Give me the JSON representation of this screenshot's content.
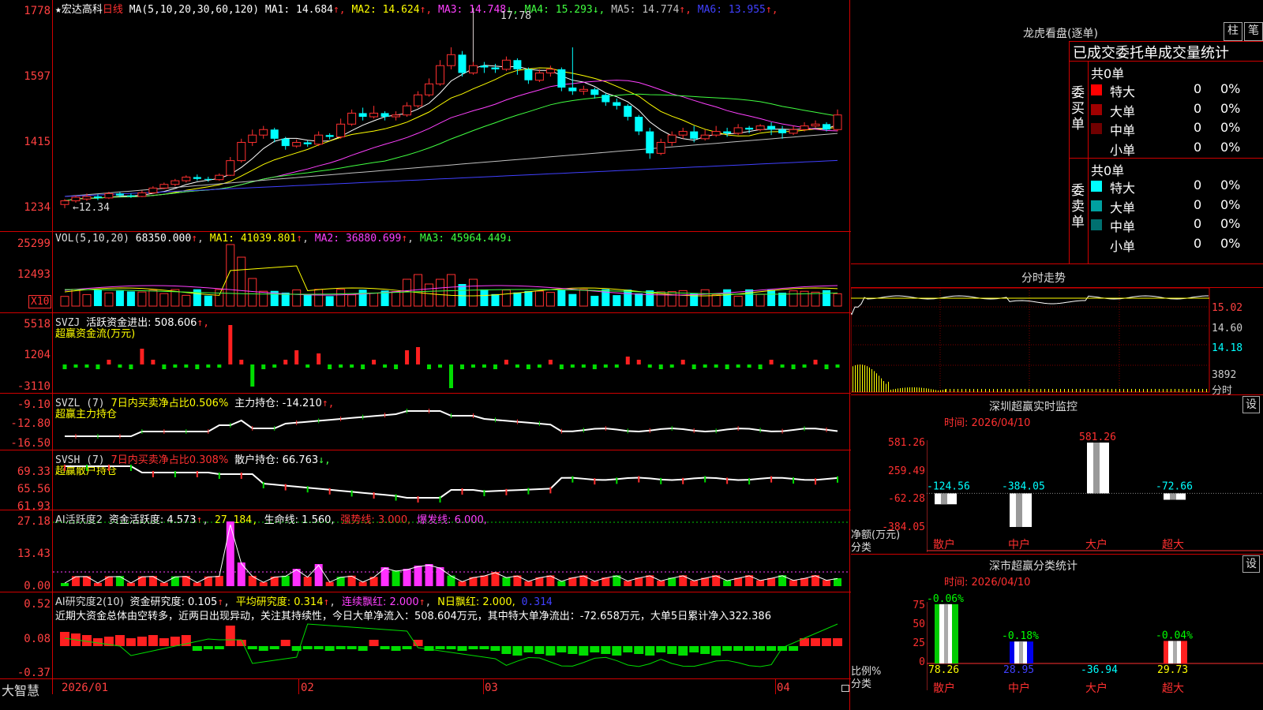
{
  "main": {
    "title_star": "★",
    "stock_name": "宏达高科",
    "period": "日线",
    "ma_label": "MA(5,10,20,30,60,120)",
    "ma": [
      {
        "name": "MA1: 14.684",
        "arrow": "↑",
        "color": "#ffffff"
      },
      {
        "name": "MA2: 14.624",
        "arrow": "↑",
        "color": "#ffff00"
      },
      {
        "name": "MA3: 14.748",
        "arrow": "↓",
        "color": "#ff40ff"
      },
      {
        "name": "MA4: 15.293",
        "arrow": "↓",
        "color": "#40ff40"
      },
      {
        "name": "MA5: 14.774",
        "arrow": "↑",
        "color": "#c0c0c0"
      },
      {
        "name": "MA6: 13.955",
        "arrow": "↑",
        "color": "#4040ff"
      }
    ],
    "high_label": "17.78",
    "low_label": "←12.34",
    "y_ticks": [
      "1778",
      "1597",
      "1415",
      "1234"
    ],
    "bottom_label": "大智慧",
    "x_labels": [
      "2026/01",
      "02",
      "03",
      "04"
    ]
  },
  "vol": {
    "label": "VOL(5,10,20)",
    "value": "68350.000",
    "arrow": "↑",
    "ma1": "MA1: 41039.801",
    "ma1_arrow": "↑",
    "ma2": "MA2: 36880.699",
    "ma2_arrow": "↑",
    "ma3": "MA3: 45964.449",
    "ma3_arrow": "↓",
    "y_ticks": [
      "25299",
      "12493"
    ],
    "unit": "X10"
  },
  "svzj": {
    "label": "SVZJ",
    "desc": "活跃资金进出: 508.606",
    "arrow": "↑,",
    "sub": "超赢资金流(万元)",
    "y_ticks": [
      "5518",
      "1204",
      "-3110"
    ]
  },
  "svzl": {
    "label": "SVZL (7)",
    "desc1": "7日内买卖净占比0.506%",
    "desc2": "主力持仓: -14.210",
    "arrow": "↑,",
    "sub": "超赢主力持仓",
    "y_ticks": [
      "-9.10",
      "-12.80",
      "-16.50"
    ]
  },
  "svsh": {
    "label": "SVSH (7)",
    "desc1": "7日内买卖净占比0.308%",
    "desc2": "散户持仓: 66.763",
    "arrow": "↓,",
    "sub": "超赢散户持仓",
    "y_ticks": [
      "69.33",
      "65.56",
      "61.93"
    ]
  },
  "ai1": {
    "label": "AI活跃度2",
    "desc": "资金活跃度: 4.573",
    "v2": "27.184,",
    "v3": "生命线: 1.560,",
    "v4": "强势线: 3.000,",
    "v5": "爆发线: 6.000,",
    "y_ticks": [
      "27.18",
      "13.43",
      "0.00"
    ]
  },
  "ai2": {
    "label": "AI研究度2(10)",
    "desc": "资金研究度: 0.105",
    "v2": "平均研究度: 0.314",
    "v3": "连续飘红: 2.000",
    "v4": "N日飘红: 2.000,",
    "v5": "0.314",
    "comment": "近期大资金总体由空转多，近两日出现异动，关注其持续性，今日大单净流入：508.604万元，其中特大单净流出：-72.658万元，大单5日累计净入322.386",
    "y_ticks": [
      "0.52",
      "0.08",
      "-0.37"
    ]
  },
  "right": {
    "title": "龙虎看盘(逐单)",
    "btn1": "柱",
    "btn2": "笔",
    "header": "已成交委托单成交量统计",
    "buy_label": "委买单",
    "sell_label": "委卖单",
    "buy_total": "共0单",
    "sell_total": "共0单",
    "buy_rows": [
      {
        "name": "特大",
        "count": "0",
        "pct": "0%",
        "color": "#ff0000"
      },
      {
        "name": "大单",
        "count": "0",
        "pct": "0%",
        "color": "#a00000"
      },
      {
        "name": "中单",
        "count": "0",
        "pct": "0%",
        "color": "#700000"
      },
      {
        "name": "小单",
        "count": "0",
        "pct": "0%",
        "color": ""
      }
    ],
    "sell_rows": [
      {
        "name": "特大",
        "count": "0",
        "pct": "0%",
        "color": "#00ffff"
      },
      {
        "name": "大单",
        "count": "0",
        "pct": "0%",
        "color": "#00a0a0"
      },
      {
        "name": "中单",
        "count": "0",
        "pct": "0%",
        "color": "#007070"
      },
      {
        "name": "小单",
        "count": "0",
        "pct": "0%",
        "color": ""
      }
    ],
    "intraday_title": "分时走势",
    "intraday_ticks": [
      "15.02",
      "14.60",
      "14.18",
      "3892",
      "分时"
    ],
    "sz_title": "深圳超赢实时监控",
    "sz_btn": "设",
    "sz_time": "时间: 2026/04/10",
    "sz_y": [
      "581.26",
      "259.49",
      "-62.28",
      "-384.05"
    ],
    "sz_axis": "净额(万元)",
    "sz_axis2": "分类",
    "sz_bars": [
      {
        "cat": "散户",
        "val": "-124.56",
        "value": -124.56
      },
      {
        "cat": "中户",
        "val": "-384.05",
        "value": -384.05
      },
      {
        "cat": "大户",
        "val": "581.26",
        "value": 581.26
      },
      {
        "cat": "超大",
        "val": "-72.66",
        "value": -72.66
      }
    ],
    "cls_title": "深市超赢分类统计",
    "cls_btn": "设",
    "cls_time": "时间: 2026/04/10",
    "cls_y": [
      "75",
      "50",
      "25",
      "0"
    ],
    "cls_axis": "比例%",
    "cls_axis2": "分类",
    "cls_bars": [
      {
        "cat": "散户",
        "top": "-0.06%",
        "bottom": "78.26",
        "value": 78.26
      },
      {
        "cat": "中户",
        "top": "-0.18%",
        "bottom": "28.95",
        "value": 28.95
      },
      {
        "cat": "大户",
        "top": "",
        "bottom": "-36.94",
        "value": 0
      },
      {
        "cat": "超大",
        "top": "-0.04%",
        "bottom": "29.73",
        "value": 29.73
      }
    ]
  },
  "chart_data": [
    {
      "type": "candlestick",
      "title": "宏达高科 日线",
      "ylim": [
        12.34,
        17.78
      ],
      "series": [
        {
          "name": "price",
          "values": [
            [
              12.4,
              12.5,
              12.3,
              12.55
            ],
            [
              12.5,
              12.6,
              12.45,
              12.65
            ],
            [
              12.55,
              12.62,
              12.5,
              12.7
            ],
            [
              12.62,
              12.58,
              12.52,
              12.68
            ],
            [
              12.58,
              12.7,
              12.55,
              12.75
            ],
            [
              12.7,
              12.65,
              12.6,
              12.74
            ],
            [
              12.65,
              12.62,
              12.58,
              12.7
            ],
            [
              12.62,
              12.72,
              12.6,
              12.78
            ],
            [
              12.72,
              12.85,
              12.7,
              12.9
            ],
            [
              12.85,
              12.95,
              12.82,
              13.0
            ],
            [
              12.95,
              13.05,
              12.9,
              13.1
            ],
            [
              13.05,
              13.15,
              13.0,
              13.2
            ],
            [
              13.15,
              13.1,
              13.05,
              13.22
            ],
            [
              13.1,
              13.08,
              13.02,
              13.16
            ],
            [
              13.08,
              13.2,
              13.05,
              13.25
            ],
            [
              13.2,
              13.6,
              13.18,
              13.7
            ],
            [
              13.6,
              14.1,
              13.55,
              14.2
            ],
            [
              14.1,
              14.3,
              14.0,
              14.45
            ],
            [
              14.3,
              14.45,
              14.2,
              14.55
            ],
            [
              14.45,
              14.2,
              14.1,
              14.5
            ],
            [
              14.2,
              14.0,
              13.9,
              14.25
            ],
            [
              14.0,
              14.1,
              13.95,
              14.18
            ],
            [
              14.1,
              14.05,
              13.98,
              14.15
            ],
            [
              14.05,
              14.3,
              14.0,
              14.4
            ],
            [
              14.3,
              14.25,
              14.18,
              14.35
            ],
            [
              14.25,
              14.6,
              14.2,
              14.75
            ],
            [
              14.6,
              14.9,
              14.55,
              15.0
            ],
            [
              14.9,
              14.8,
              14.7,
              15.05
            ],
            [
              14.8,
              14.9,
              14.75,
              15.1
            ],
            [
              14.9,
              14.8,
              14.7,
              14.95
            ],
            [
              14.8,
              14.85,
              14.7,
              14.95
            ],
            [
              14.85,
              15.1,
              14.8,
              15.2
            ],
            [
              15.1,
              15.4,
              15.05,
              15.5
            ],
            [
              15.4,
              15.7,
              15.35,
              15.85
            ],
            [
              15.7,
              16.2,
              15.65,
              16.35
            ],
            [
              16.2,
              16.5,
              16.1,
              16.7
            ],
            [
              16.5,
              16.0,
              15.9,
              16.6
            ],
            [
              16.0,
              16.2,
              15.95,
              17.78
            ],
            [
              16.2,
              16.15,
              16.0,
              16.3
            ],
            [
              16.15,
              16.1,
              16.0,
              16.25
            ],
            [
              16.1,
              16.35,
              16.05,
              16.45
            ],
            [
              16.35,
              16.1,
              15.95,
              16.4
            ],
            [
              16.1,
              15.8,
              15.7,
              16.15
            ],
            [
              15.8,
              16.0,
              15.75,
              16.1
            ],
            [
              16.0,
              16.1,
              15.9,
              16.2
            ],
            [
              16.1,
              15.6,
              15.5,
              16.15
            ],
            [
              15.6,
              15.5,
              15.4,
              16.7
            ],
            [
              15.5,
              15.55,
              15.4,
              15.65
            ],
            [
              15.55,
              15.4,
              15.3,
              15.6
            ],
            [
              15.4,
              15.2,
              15.1,
              15.45
            ],
            [
              15.2,
              15.1,
              15.0,
              15.3
            ],
            [
              15.1,
              14.8,
              14.7,
              15.15
            ],
            [
              14.8,
              14.4,
              14.3,
              14.85
            ],
            [
              14.4,
              13.8,
              13.65,
              14.5
            ],
            [
              13.8,
              14.1,
              13.75,
              14.2
            ],
            [
              14.1,
              14.3,
              14.0,
              14.4
            ],
            [
              14.3,
              14.4,
              14.2,
              14.5
            ],
            [
              14.4,
              14.2,
              14.1,
              14.55
            ],
            [
              14.2,
              14.3,
              14.15,
              14.45
            ],
            [
              14.3,
              14.4,
              14.25,
              14.55
            ],
            [
              14.4,
              14.35,
              14.25,
              14.5
            ],
            [
              14.35,
              14.5,
              14.3,
              14.6
            ],
            [
              14.5,
              14.45,
              14.35,
              14.55
            ],
            [
              14.45,
              14.55,
              14.4,
              14.6
            ],
            [
              14.55,
              14.45,
              14.3,
              14.65
            ],
            [
              14.45,
              14.35,
              14.2,
              14.55
            ],
            [
              14.35,
              14.45,
              14.3,
              14.55
            ],
            [
              14.45,
              14.55,
              14.4,
              14.65
            ],
            [
              14.55,
              14.6,
              14.5,
              14.7
            ],
            [
              14.6,
              14.45,
              14.4,
              14.65
            ],
            [
              14.45,
              14.85,
              14.4,
              15.0
            ]
          ]
        }
      ]
    }
  ]
}
